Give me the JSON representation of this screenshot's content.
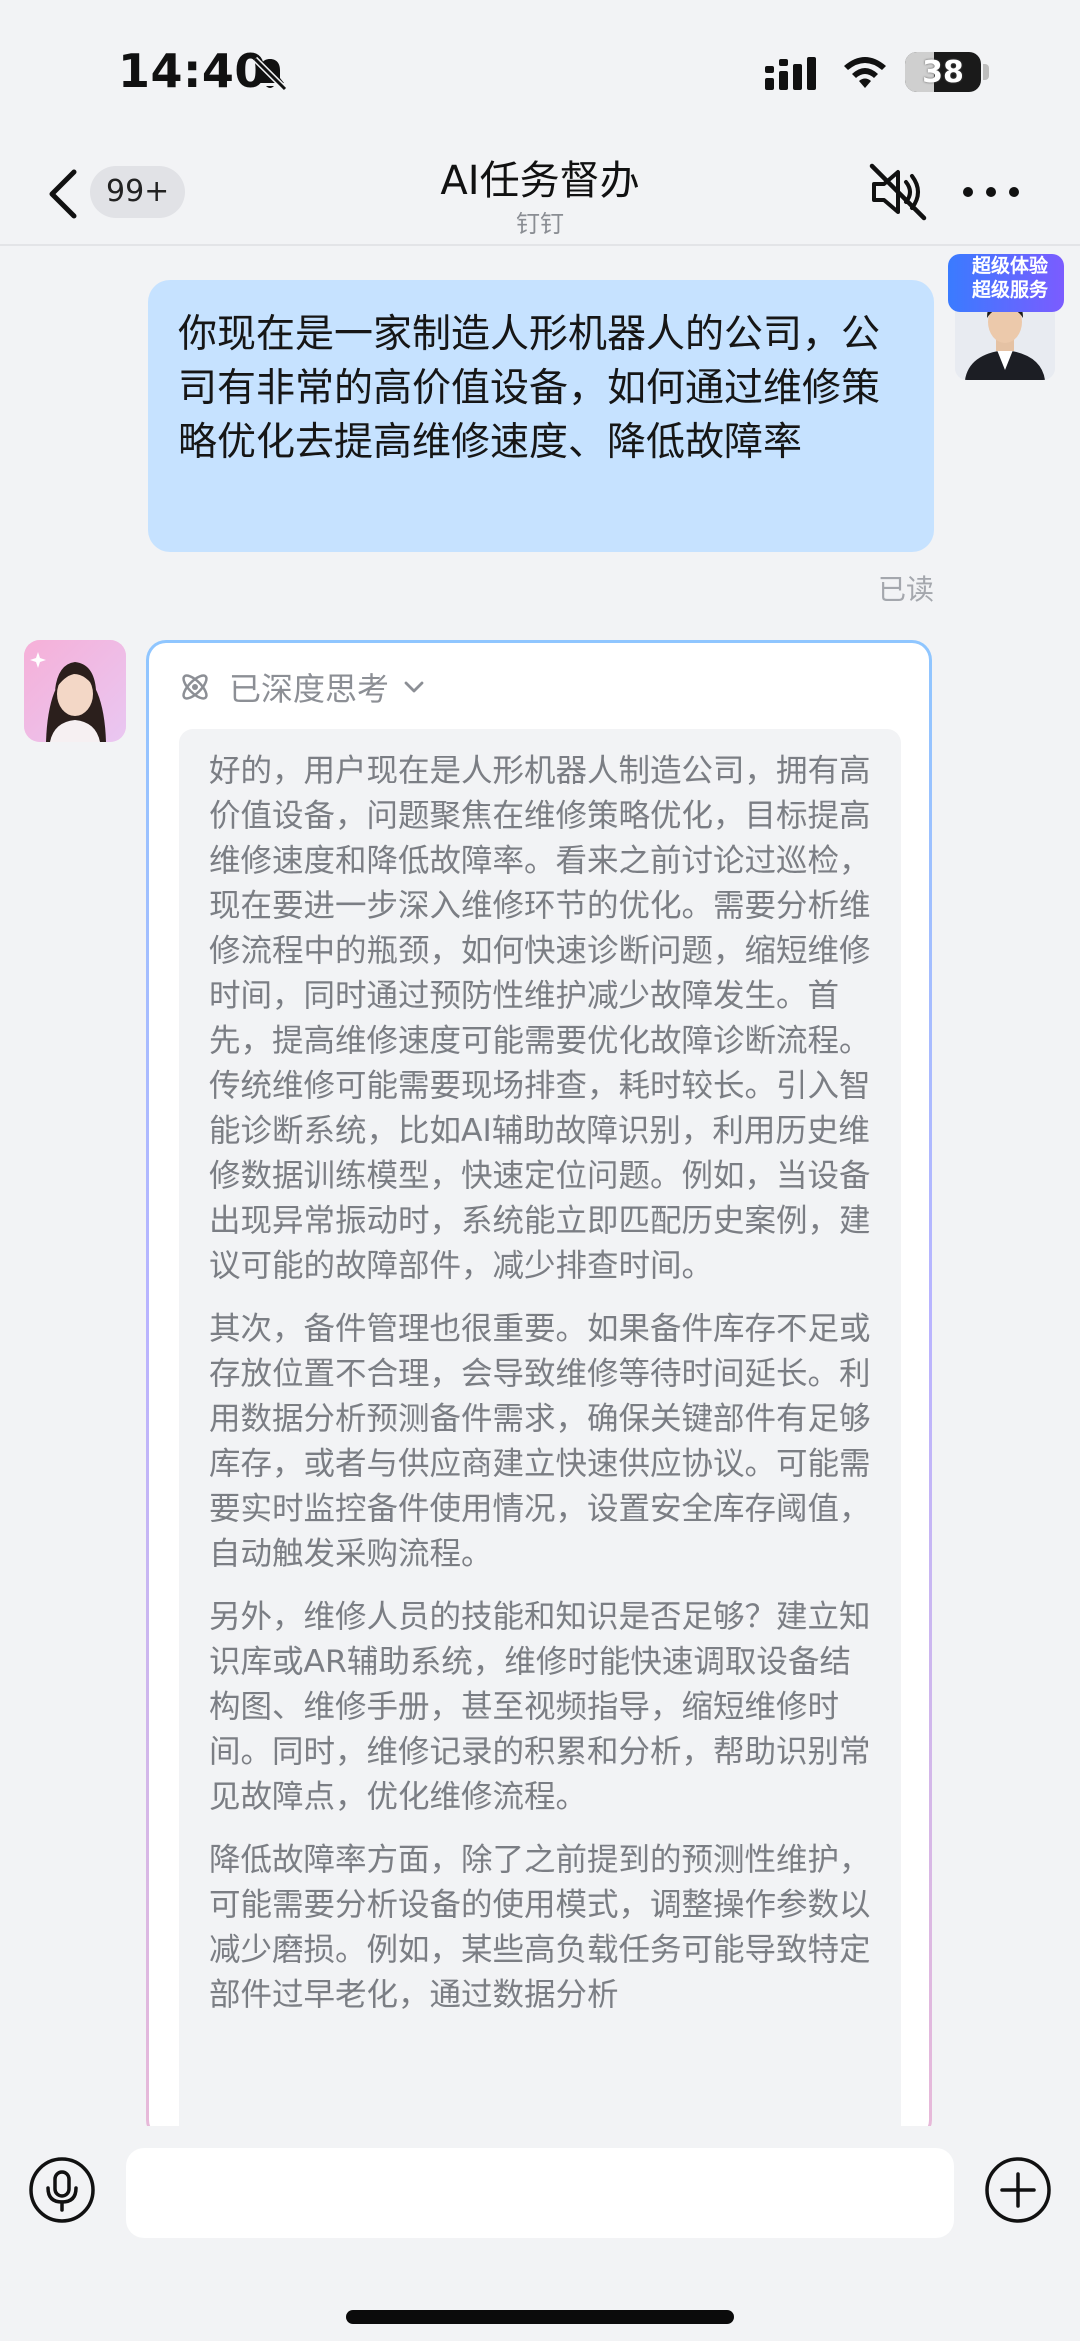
{
  "status_bar": {
    "time": "14:40",
    "battery_level": "38",
    "battery_fraction": 0.38,
    "icons": [
      "bell-slash-icon",
      "signal-icon",
      "wifi-icon",
      "battery-icon"
    ]
  },
  "nav": {
    "back_icon": "chevron-left-icon",
    "unread_badge": "99+",
    "title": "AI任务督办",
    "subtitle": "钉钉",
    "mute_icon": "speaker-muted-icon",
    "more_icon": "more-dots-icon"
  },
  "user_message": {
    "text": "你现在是一家制造人形机器人的公司，公司有非常的高价值设备，如何通过维修策略优化去提高维修速度、降低故障率",
    "avatar_badge": "超级体验\n超级服务",
    "read_status": "已读"
  },
  "bot_message": {
    "think_label": "已深度思考",
    "paragraphs": [
      "好的，用户现在是人形机器人制造公司，拥有高价值设备，问题聚焦在维修策略优化，目标提高维修速度和降低故障率。看来之前讨论过巡检，现在要进一步深入维修环节的优化。需要分析维修流程中的瓶颈，如何快速诊断问题，缩短维修时间，同时通过预防性维护减少故障发生。首先，提高维修速度可能需要优化故障诊断流程。传统维修可能需要现场排查，耗时较长。引入智能诊断系统，比如AI辅助故障识别，利用历史维修数据训练模型，快速定位问题。例如，当设备出现异常振动时，系统能立即匹配历史案例，建议可能的故障部件，减少排查时间。",
      "其次，备件管理也很重要。如果备件库存不足或存放位置不合理，会导致维修等待时间延长。利用数据分析预测备件需求，确保关键部件有足够库存，或者与供应商建立快速供应协议。可能需要实时监控备件使用情况，设置安全库存阈值，自动触发采购流程。",
      "另外，维修人员的技能和知识是否足够？建立知识库或AR辅助系统，维修时能快速调取设备结构图、维修手册，甚至视频指导，缩短维修时间。同时，维修记录的积累和分析，帮助识别常见故障点，优化维修流程。",
      "降低故障率方面，除了之前提到的预测性维护，可能需要分析设备的使用模式，调整操作参数以减少磨损。例如，某些高负载任务可能导致特定部件过早老化，通过数据分析"
    ]
  },
  "composer": {
    "mic_icon": "microphone-icon",
    "input_value": "",
    "plus_icon": "plus-circle-icon"
  }
}
